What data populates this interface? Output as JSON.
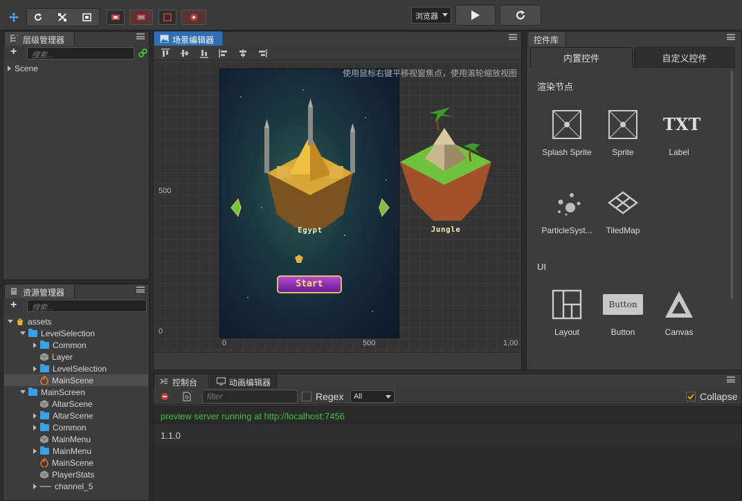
{
  "toolbar": {
    "tools": [
      "move-tool",
      "rotate-tool",
      "scale-tool",
      "rect-tool"
    ],
    "platform_select": "浏览器"
  },
  "hierarchy": {
    "title": "层级管理器",
    "search_placeholder": "搜索...",
    "items": [
      {
        "label": "Scene"
      }
    ]
  },
  "assets": {
    "title": "资源管理器",
    "search_placeholder": "搜索...",
    "items": [
      {
        "label": "assets",
        "type": "root"
      },
      {
        "label": "LevelSelection",
        "type": "folder"
      },
      {
        "label": "Common",
        "type": "folder"
      },
      {
        "label": "Layer",
        "type": "prefab"
      },
      {
        "label": "LevelSelection",
        "type": "folder"
      },
      {
        "label": "MainScene",
        "type": "scene",
        "selected": true
      },
      {
        "label": "MainScreen",
        "type": "folder"
      },
      {
        "label": "AltarScene",
        "type": "prefab"
      },
      {
        "label": "AltarScene",
        "type": "folder"
      },
      {
        "label": "Common",
        "type": "folder"
      },
      {
        "label": "MainMenu",
        "type": "prefab"
      },
      {
        "label": "MainMenu",
        "type": "folder"
      },
      {
        "label": "MainScene",
        "type": "scene"
      },
      {
        "label": "PlayerStats",
        "type": "prefab"
      },
      {
        "label": "channel_5",
        "type": "file"
      }
    ]
  },
  "scene_editor": {
    "title": "场景编辑器",
    "hint": "使用鼠标右键平移视窗焦点，使用滚轮缩放视图",
    "y_axis": [
      "500",
      "0"
    ],
    "x_axis": [
      "0",
      "500",
      "1,00"
    ],
    "game": {
      "left_level": "Egypt",
      "right_level": "Jungle",
      "start_button": "Start"
    }
  },
  "library": {
    "title": "控件库",
    "tabs": [
      {
        "label": "内置控件",
        "active": true
      },
      {
        "label": "自定义控件",
        "active": false
      }
    ],
    "sections": [
      {
        "title": "渲染节点",
        "widgets": [
          {
            "label": "Splash Sprite",
            "icon": "splash-sprite-icon"
          },
          {
            "label": "Sprite",
            "icon": "sprite-icon"
          },
          {
            "label": "Label",
            "icon": "label-txt-icon",
            "glyph": "TXT"
          },
          {
            "label": "ParticleSyst...",
            "icon": "particle-system-icon"
          },
          {
            "label": "TiledMap",
            "icon": "tiledmap-icon"
          }
        ]
      },
      {
        "title": "UI",
        "widgets": [
          {
            "label": "Layout",
            "icon": "layout-icon"
          },
          {
            "label": "Button",
            "icon": "button-icon",
            "glyph": "Button"
          },
          {
            "label": "Canvas",
            "icon": "canvas-icon"
          }
        ]
      }
    ]
  },
  "console": {
    "tabs": [
      {
        "label": "控制台"
      },
      {
        "label": "动画编辑器"
      }
    ],
    "filter_placeholder": "filter",
    "regex_label": "Regex",
    "level_select": "All",
    "collapse_label": "Collapse",
    "collapse_checked": true,
    "logs": [
      {
        "text": "preview server running at http://localhost:7456",
        "color": "#3cc43c"
      },
      {
        "text": "1.1.0",
        "color": "#cfcfcf"
      }
    ]
  }
}
